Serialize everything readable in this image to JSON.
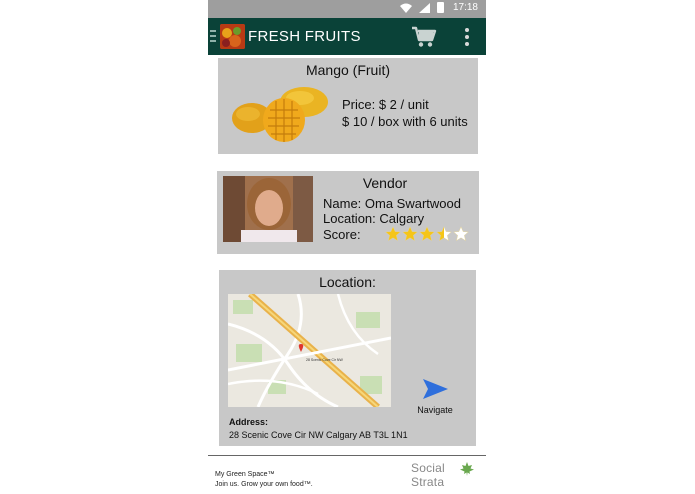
{
  "status_bar": {
    "time": "17:18"
  },
  "app_bar": {
    "title": "FRESH FRUITS"
  },
  "product": {
    "name": "Mango (Fruit)",
    "price_unit": "Price: $ 2 / unit",
    "price_box": "$ 10 / box with 6 units"
  },
  "vendor": {
    "heading": "Vendor",
    "name": "Name: Oma Swartwood",
    "location": "Location: Calgary",
    "score_label": "Score:",
    "score": 3.5,
    "score_max": 5
  },
  "location": {
    "heading": "Location:",
    "navigate_label": "Navigate",
    "address_label": "Address:",
    "address": "28 Scenic Cove Cir NW Calgary AB T3L 1N1"
  },
  "footer": {
    "line1": "My Green Space™",
    "line2": "Join us. Grow your own food™.",
    "brand": "Social Strata"
  },
  "colors": {
    "app_bar": "#0a4238",
    "card": "#c8c8c8",
    "status_bar": "#9e9e9e",
    "star": "#f5c518",
    "navigate_arrow": "#2f6fdc"
  }
}
